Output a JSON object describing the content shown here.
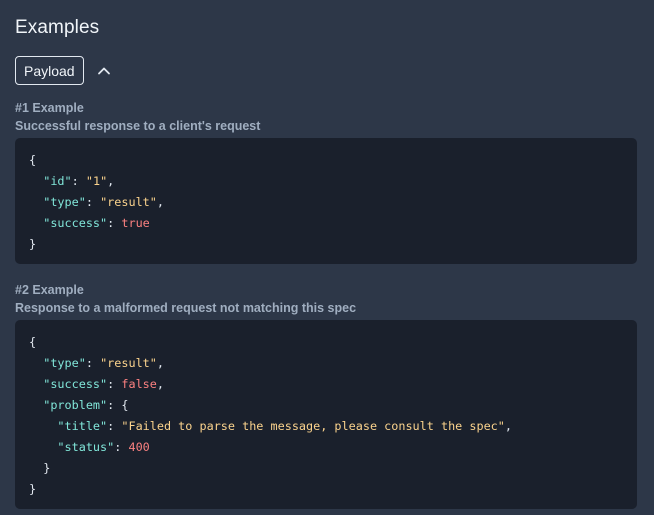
{
  "section": {
    "title": "Examples"
  },
  "toolbar": {
    "payload_label": "Payload",
    "toggle_icon": "chevron-up-icon"
  },
  "examples": [
    {
      "heading": "#1 Example",
      "description": "Successful response to a client's request",
      "code": {
        "open": "{",
        "id_key": "\"id\"",
        "id_value": "\"1\"",
        "type_key": "\"type\"",
        "type_value": "\"result\"",
        "success_key": "\"success\"",
        "success_value": "true",
        "close": "}"
      }
    },
    {
      "heading": "#2 Example",
      "description": "Response to a malformed request not matching this spec",
      "code": {
        "open": "{",
        "type_key": "\"type\"",
        "type_value": "\"result\"",
        "success_key": "\"success\"",
        "success_value": "false",
        "problem_key": "\"problem\"",
        "problem_open": "{",
        "title_key": "\"title\"",
        "title_value": "\"Failed to parse the message, please consult the spec\"",
        "status_key": "\"status\"",
        "status_value": "400",
        "problem_close": "}",
        "close": "}"
      }
    }
  ],
  "colors": {
    "background": "#2d3748",
    "code_background": "#1a202c",
    "json_key": "#81e6d9",
    "json_string": "#fbd38d",
    "json_literal": "#fc8181"
  }
}
